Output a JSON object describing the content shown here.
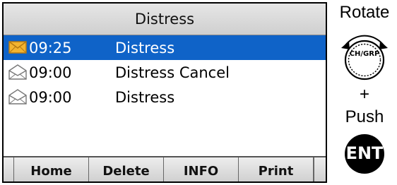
{
  "screen": {
    "title": "Distress",
    "rows": [
      {
        "time": "09:25",
        "text": "Distress",
        "icon": "envelope-closed-icon",
        "selected": true
      },
      {
        "time": "09:00",
        "text": "Distress Cancel",
        "icon": "envelope-open-icon",
        "selected": false
      },
      {
        "time": "09:00",
        "text": "Distress",
        "icon": "envelope-open-icon",
        "selected": false
      }
    ],
    "softkeys": [
      "Home",
      "Delete",
      "INFO",
      "Print"
    ]
  },
  "side": {
    "rotate_label": "Rotate",
    "knob_label": "CH/GRP",
    "plus": "+",
    "push_label": "Push",
    "ent_label": "ENT"
  },
  "colors": {
    "selected_row": "#0f63c8",
    "envelope_unread": "#f2b431"
  }
}
